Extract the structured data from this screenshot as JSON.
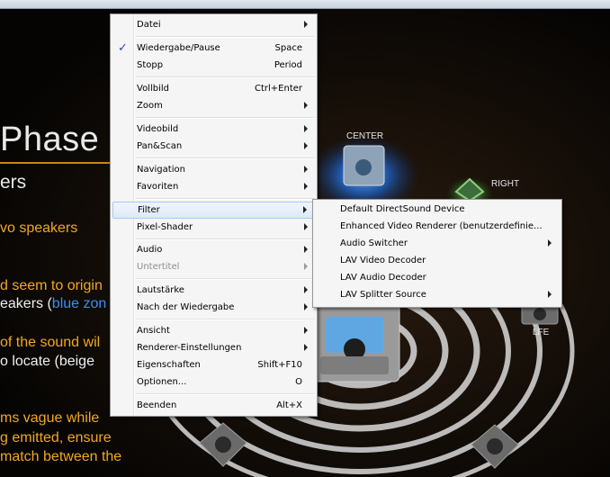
{
  "slide": {
    "title": "Phase",
    "subtitle": "ers",
    "lines": [
      {
        "text": "vo speakers",
        "color": "orange"
      },
      {
        "text": "d seem to origin",
        "color": "orange"
      },
      {
        "text": "eakers (",
        "color": "white",
        "extra": "blue zon"
      },
      {
        "text": "of the sound wil",
        "color": "orange"
      },
      {
        "text": "o locate (",
        "color": "white",
        "extra": "beige"
      },
      {
        "text": "ms vague while",
        "color": "orange"
      },
      {
        "text": "g emitted, ensure",
        "color": "orange"
      },
      {
        "text": "match between the",
        "color": "orange"
      }
    ],
    "speaker_labels": {
      "center": "CENTER",
      "right": "RIGHT",
      "lfe": "LFE"
    }
  },
  "context_menu": {
    "items": [
      {
        "label": "Datei",
        "shortcut": "",
        "submenu": true
      },
      {
        "label": "Wiedergabe/Pause",
        "shortcut": "Space",
        "checked": true
      },
      {
        "label": "Stopp",
        "shortcut": "Period"
      },
      {
        "label": "Vollbild",
        "shortcut": "Ctrl+Enter"
      },
      {
        "label": "Zoom",
        "shortcut": "",
        "submenu": true
      },
      {
        "label": "Videobild",
        "shortcut": "",
        "submenu": true
      },
      {
        "label": "Pan&Scan",
        "shortcut": "",
        "submenu": true
      },
      {
        "label": "Navigation",
        "shortcut": "",
        "submenu": true
      },
      {
        "label": "Favoriten",
        "shortcut": "",
        "submenu": true
      },
      {
        "label": "Filter",
        "shortcut": "",
        "submenu": true,
        "highlighted": true
      },
      {
        "label": "Pixel-Shader",
        "shortcut": "",
        "submenu": true
      },
      {
        "label": "Audio",
        "shortcut": "",
        "submenu": true
      },
      {
        "label": "Untertitel",
        "shortcut": "",
        "submenu": true,
        "disabled": true
      },
      {
        "label": "Lautstärke",
        "shortcut": "",
        "submenu": true
      },
      {
        "label": "Nach der Wiedergabe",
        "shortcut": "",
        "submenu": true
      },
      {
        "label": "Ansicht",
        "shortcut": "",
        "submenu": true
      },
      {
        "label": "Renderer-Einstellungen",
        "shortcut": "",
        "submenu": true
      },
      {
        "label": "Eigenschaften",
        "shortcut": "Shift+F10"
      },
      {
        "label": "Optionen...",
        "shortcut": "O"
      },
      {
        "label": "Beenden",
        "shortcut": "Alt+X"
      }
    ]
  },
  "filter_submenu": {
    "items": [
      {
        "label": "Default DirectSound Device"
      },
      {
        "label": "Enhanced Video Renderer (benutzerdefinie..."
      },
      {
        "label": "Audio Switcher",
        "submenu": true
      },
      {
        "label": "LAV Video Decoder"
      },
      {
        "label": "LAV Audio Decoder"
      },
      {
        "label": "LAV Splitter Source",
        "submenu": true
      }
    ]
  },
  "colors": {
    "accent_orange": "#f2a81e",
    "accent_blue": "#3b8ff0",
    "highlight": "#dde9f8"
  }
}
